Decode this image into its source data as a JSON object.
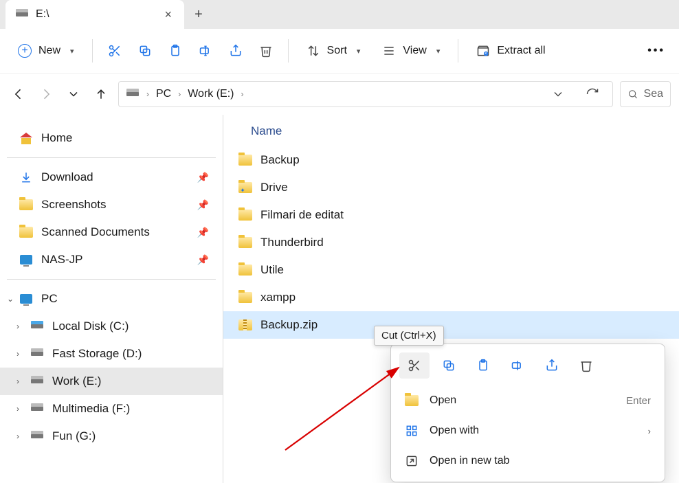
{
  "tab": {
    "title": "E:\\"
  },
  "toolbar": {
    "new_label": "New",
    "sort_label": "Sort",
    "view_label": "View",
    "extract_label": "Extract all"
  },
  "breadcrumb": {
    "seg1": "PC",
    "seg2": "Work (E:)"
  },
  "search": {
    "placeholder": "Sea"
  },
  "sidebar": {
    "home": "Home",
    "quick": [
      {
        "label": "Download"
      },
      {
        "label": "Screenshots"
      },
      {
        "label": "Scanned Documents"
      },
      {
        "label": "NAS-JP"
      }
    ],
    "pc": {
      "label": "PC"
    },
    "drives": [
      {
        "label": "Local Disk (C:)"
      },
      {
        "label": "Fast Storage (D:)"
      },
      {
        "label": "Work (E:)"
      },
      {
        "label": "Multimedia (F:)"
      },
      {
        "label": "Fun (G:)"
      }
    ]
  },
  "main": {
    "header_name": "Name",
    "items": [
      {
        "label": "Backup",
        "type": "folder"
      },
      {
        "label": "Drive",
        "type": "folder"
      },
      {
        "label": "Filmari de editat",
        "type": "folder"
      },
      {
        "label": "Thunderbird",
        "type": "folder"
      },
      {
        "label": "Utile",
        "type": "folder"
      },
      {
        "label": "xampp",
        "type": "folder"
      },
      {
        "label": "Backup.zip",
        "type": "zip"
      }
    ]
  },
  "tooltip": {
    "text": "Cut (Ctrl+X)"
  },
  "context": {
    "open": "Open",
    "open_shortcut": "Enter",
    "openwith": "Open with",
    "opennewtab": "Open in new tab"
  }
}
